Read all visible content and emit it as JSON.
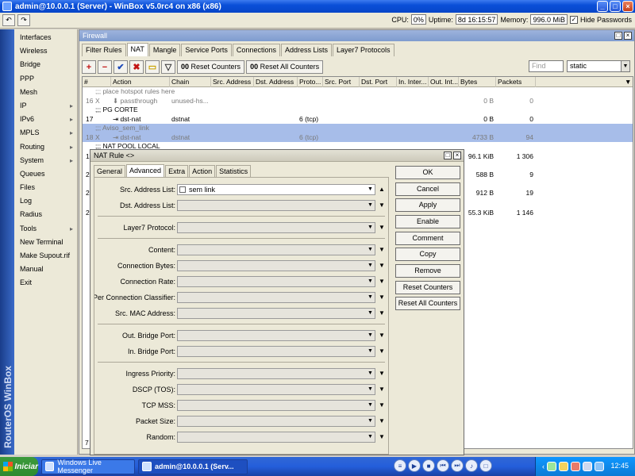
{
  "titlebar": {
    "title": "admin@10.0.0.1 (Server) - WinBox v5.0rc4 on x86 (x86)"
  },
  "toolbar": {
    "cpu_label": "CPU:",
    "cpu_value": "0%",
    "uptime_label": "Uptime:",
    "uptime_value": "8d 16:15:57",
    "memory_label": "Memory:",
    "memory_value": "996.0 MiB",
    "hide_passwords_label": "Hide Passwords"
  },
  "sidebar": {
    "brand": "RouterOS WinBox",
    "items": [
      {
        "label": "Interfaces",
        "arrow": ""
      },
      {
        "label": "Wireless",
        "arrow": ""
      },
      {
        "label": "Bridge",
        "arrow": ""
      },
      {
        "label": "PPP",
        "arrow": ""
      },
      {
        "label": "Mesh",
        "arrow": ""
      },
      {
        "label": "IP",
        "arrow": "▸"
      },
      {
        "label": "IPv6",
        "arrow": "▸"
      },
      {
        "label": "MPLS",
        "arrow": "▸"
      },
      {
        "label": "Routing",
        "arrow": "▸"
      },
      {
        "label": "System",
        "arrow": "▸"
      },
      {
        "label": "Queues",
        "arrow": ""
      },
      {
        "label": "Files",
        "arrow": ""
      },
      {
        "label": "Log",
        "arrow": ""
      },
      {
        "label": "Radius",
        "arrow": ""
      },
      {
        "label": "Tools",
        "arrow": "▸"
      },
      {
        "label": "New Terminal",
        "arrow": ""
      },
      {
        "label": "Make Supout.rif",
        "arrow": ""
      },
      {
        "label": "Manual",
        "arrow": ""
      },
      {
        "label": "Exit",
        "arrow": ""
      }
    ]
  },
  "firewall": {
    "title": "Firewall",
    "tabs": [
      "Filter Rules",
      "NAT",
      "Mangle",
      "Service Ports",
      "Connections",
      "Address Lists",
      "Layer7 Protocols"
    ],
    "reset_counters": "Reset Counters",
    "reset_all_counters": "Reset All Counters",
    "find_placeholder": "Find",
    "filter_value": "static",
    "columns": [
      "#",
      "Action",
      "Chain",
      "Src. Address",
      "Dst. Address",
      "Proto...",
      "Src. Port",
      "Dst. Port",
      "In. Inter...",
      "Out. Int...",
      "Bytes",
      "Packets"
    ],
    "rows": [
      {
        "type": "comment",
        "text": ";;; place hotspot rules here"
      },
      {
        "type": "rule",
        "num": "16",
        "flag": "X",
        "action": "passthrough",
        "chain": "unused-hs...",
        "proto": "",
        "bytes": "0 B",
        "packets": "0",
        "disabled": true
      },
      {
        "type": "comment",
        "text": ";;; PG CORTE",
        "dark": true
      },
      {
        "type": "rule",
        "num": "17",
        "flag": "",
        "action": "dst-nat",
        "chain": "dstnat",
        "proto": "6 (tcp)",
        "bytes": "0 B",
        "packets": "0",
        "disabled": false
      },
      {
        "type": "comment",
        "text": ";;; Aviso_sem_link",
        "selected": true
      },
      {
        "type": "rule",
        "num": "18",
        "flag": "X",
        "action": "dst-nat",
        "chain": "dstnat",
        "proto": "6 (tcp)",
        "bytes": "4733 B",
        "packets": "94",
        "disabled": true,
        "selected": true
      },
      {
        "type": "comment",
        "text": ";;; NAT POOL LOCAL",
        "dark": true
      },
      {
        "type": "rule",
        "num": "1",
        "flag": "",
        "action": "",
        "chain": "",
        "proto": "",
        "bytes": "96.1 KiB",
        "packets": "1 306",
        "disabled": false
      }
    ],
    "extra_rows": [
      {
        "num": "2",
        "bytes": "588 B",
        "packets": "9"
      },
      {
        "num": "2",
        "bytes": "912 B",
        "packets": "19"
      },
      {
        "num": "2",
        "bytes": "55.3 KiB",
        "packets": "1 146"
      }
    ],
    "footer": "7 it"
  },
  "dialog": {
    "title": "NAT Rule <>",
    "tabs": [
      "General",
      "Advanced",
      "Extra",
      "Action",
      "Statistics"
    ],
    "fields": [
      {
        "label": "Src. Address List:",
        "value": "sem link"
      },
      {
        "label": "Dst. Address List:",
        "value": ""
      },
      {
        "label": "Layer7 Protocol:",
        "value": ""
      },
      {
        "label": "Content:",
        "value": ""
      },
      {
        "label": "Connection Bytes:",
        "value": ""
      },
      {
        "label": "Connection Rate:",
        "value": ""
      },
      {
        "label": "Per Connection Classifier:",
        "value": ""
      },
      {
        "label": "Src. MAC Address:",
        "value": ""
      },
      {
        "label": "Out. Bridge Port:",
        "value": ""
      },
      {
        "label": "In. Bridge Port:",
        "value": ""
      },
      {
        "label": "Ingress Priority:",
        "value": ""
      },
      {
        "label": "DSCP (TOS):",
        "value": ""
      },
      {
        "label": "TCP MSS:",
        "value": ""
      },
      {
        "label": "Packet Size:",
        "value": ""
      },
      {
        "label": "Random:",
        "value": ""
      }
    ],
    "buttons": {
      "ok": "OK",
      "cancel": "Cancel",
      "apply": "Apply",
      "enable": "Enable",
      "comment": "Comment",
      "copy": "Copy",
      "remove": "Remove",
      "reset_counters": "Reset Counters",
      "reset_all_counters": "Reset All Counters"
    }
  },
  "taskbar": {
    "start": "Iniciar",
    "tasks": [
      "Windows Live Messenger",
      "admin@10.0.0.1 (Serv..."
    ],
    "clock": "12:45"
  }
}
